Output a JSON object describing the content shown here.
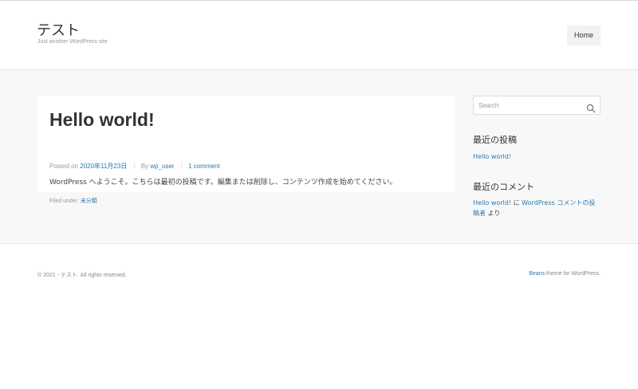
{
  "site": {
    "title": "テスト",
    "tagline": "Just another WordPress site"
  },
  "nav": {
    "home_label": "Home"
  },
  "post": {
    "title": "Hello world!",
    "meta": {
      "posted_on_label": "Posted on",
      "date": "2020年11月23日",
      "by_label": "By",
      "author": "wp_user",
      "comments": "1 comment"
    },
    "body": "WordPress へようこそ。こちらは最初の投稿です。編集または削除し、コンテンツ作成を始めてください。",
    "filed_under_label": "Filed under:",
    "category": "未分類"
  },
  "sidebar": {
    "search_placeholder": "Search",
    "recent_posts": {
      "title": "最近の投稿",
      "items": [
        "Hello world!"
      ]
    },
    "recent_comments": {
      "title": "最近のコメント",
      "post_link": "Hello world!",
      "connector": "に",
      "author_link_part1": "WordPress コメントの投",
      "author_link_part2": "稿者",
      "suffix": "より"
    }
  },
  "footer": {
    "copyright": "© 2021 - テスト. All rights reserved.",
    "credit_link": "Beans",
    "credit_text": "theme for WordPress."
  },
  "colors": {
    "link": "#2a7ab0",
    "band_background": "#f8f8f8",
    "nav_button_background": "#f2f2f2"
  },
  "icons": {
    "search": "search-icon"
  }
}
